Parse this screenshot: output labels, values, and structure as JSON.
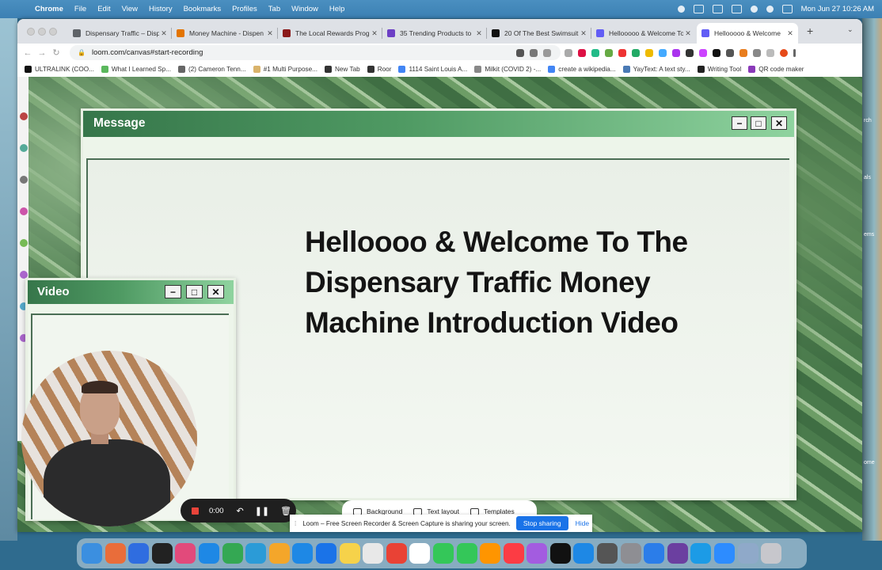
{
  "menubar": {
    "app": "Chrome",
    "items": [
      "File",
      "Edit",
      "View",
      "History",
      "Bookmarks",
      "Profiles",
      "Tab",
      "Window",
      "Help"
    ],
    "clock": "Mon Jun 27  10:26 AM"
  },
  "tabs": [
    {
      "title": "Dispensary Traffic – Disp",
      "fav": "#5f6368"
    },
    {
      "title": "Money Machine - Dispen",
      "fav": "#e37400"
    },
    {
      "title": "The Local Rewards Progr",
      "fav": "#8b1a1a"
    },
    {
      "title": "35 Trending Products to",
      "fav": "#6c3fc5"
    },
    {
      "title": "20 Of The Best Swimsuit",
      "fav": "#111111"
    },
    {
      "title": "Hellooooo & Welcome To T",
      "fav": "#625df5"
    },
    {
      "title": "Hellooooo & Welcome",
      "fav": "#625df5"
    }
  ],
  "url": "loom.com/canvas#start-recording",
  "bookmarks": [
    {
      "label": "ULTRALINK (COO...",
      "fav": "#111111"
    },
    {
      "label": "What I Learned Sp...",
      "fav": "#5bb85d"
    },
    {
      "label": "(2) Cameron Tenn...",
      "fav": "#666666"
    },
    {
      "label": "#1 Multi Purpose...",
      "fav": "#d9b36b"
    },
    {
      "label": "New Tab",
      "fav": "#333333"
    },
    {
      "label": "Roor",
      "fav": "#333333"
    },
    {
      "label": "1114 Saint Louis A...",
      "fav": "#4285f4"
    },
    {
      "label": "Milkit (COVID 2) -...",
      "fav": "#888888"
    },
    {
      "label": "create a wikipedia...",
      "fav": "#4285f4"
    },
    {
      "label": "YayText: A text sty...",
      "fav": "#4a7ab5"
    },
    {
      "label": "Writing Tool",
      "fav": "#222222"
    },
    {
      "label": "QR code maker",
      "fav": "#8a3ab9"
    }
  ],
  "message_window": {
    "title": "Message",
    "headline": "Helloooo & Welcome To The Dispensary Traffic Money Machine Introduction Video",
    "minimize_glyph": "−",
    "maximize_glyph": "□",
    "close_glyph": "✕"
  },
  "video_window": {
    "title": "Video"
  },
  "recorder": {
    "time": "0:00"
  },
  "canvas_tools": [
    "Background",
    "Text layout",
    "Templates"
  ],
  "share_notice": {
    "message": "Loom – Free Screen Recorder & Screen Capture is sharing your screen.",
    "stop_label": "Stop sharing",
    "hide_label": "Hide"
  },
  "desktop_labels": [
    "rch",
    "als",
    "ems",
    "ome"
  ],
  "dock_colors": [
    "#3b8fe0",
    "#e96d3a",
    "#2f6de0",
    "#222222",
    "#e24a7b",
    "#1e88e5",
    "#34a853",
    "#2b9bd7",
    "#f4a62a",
    "#1e88e5",
    "#1a73e8",
    "#f6d24a",
    "#e8e8e8",
    "#e94235",
    "#ffffff",
    "#34c759",
    "#34c759",
    "#ff9500",
    "#fc3c44",
    "#a35ce0",
    "#111111",
    "#1e88e5",
    "#555555",
    "#8e8e93",
    "#2b7de9",
    "#6b3fa0",
    "#1c9be6",
    "#2d8cff",
    "#8fa9c9",
    "#c7c7cc"
  ]
}
